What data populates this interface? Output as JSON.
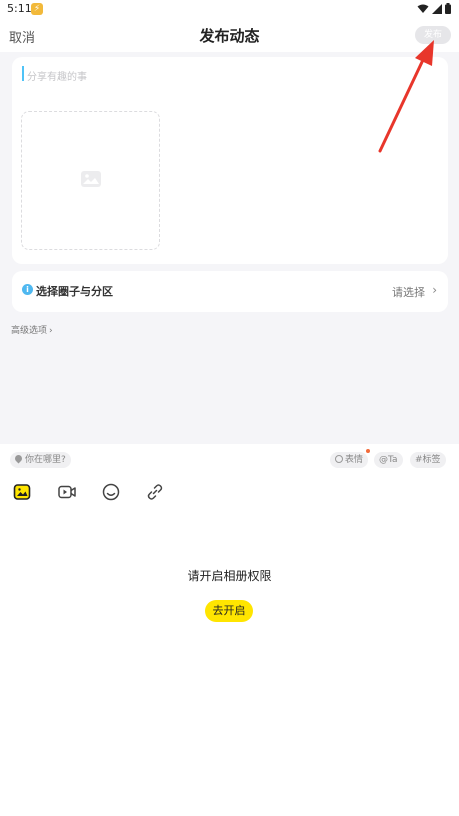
{
  "status_bar": {
    "time": "5:11",
    "badge_symbol": "⚡"
  },
  "nav": {
    "cancel": "取消",
    "title": "发布动态",
    "publish": "发布"
  },
  "post": {
    "placeholder": "分享有趣的事",
    "image_slot_icon": "image-placeholder-icon"
  },
  "circle": {
    "label": "选择圈子与分区",
    "select": "请选择",
    "chevron": "›",
    "info_symbol": "i"
  },
  "advanced": {
    "label": "高级选项",
    "chevron": "›"
  },
  "chips": {
    "location": "你在哪里?",
    "emoji": "表情",
    "at": "Ta",
    "tag": "标签"
  },
  "toolbar": [
    "image-icon",
    "video-icon",
    "emoji-icon",
    "link-icon"
  ],
  "permission": {
    "message": "请开启相册权限",
    "button": "去开启"
  },
  "colors": {
    "accent_yellow": "#ffe500",
    "arrow_red": "#e8362b",
    "info_blue": "#4fb8f0",
    "publish_disabled": "#e6e6e9"
  }
}
